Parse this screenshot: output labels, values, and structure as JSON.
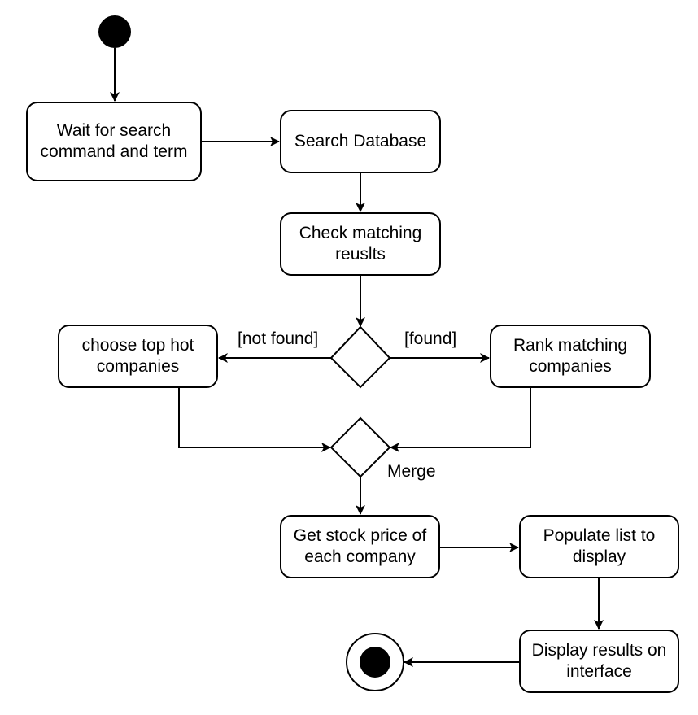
{
  "diagram": {
    "type": "UML activity diagram",
    "start": {
      "name": "initial-node"
    },
    "end": {
      "name": "final-node"
    },
    "activities": [
      {
        "id": "wait",
        "label": "Wait for search command and term"
      },
      {
        "id": "search",
        "label": "Search Database"
      },
      {
        "id": "check",
        "label": "Check matching reuslts"
      },
      {
        "id": "choose",
        "label": "choose top hot companies"
      },
      {
        "id": "rank",
        "label": "Rank matching companies"
      },
      {
        "id": "getprice",
        "label": "Get stock price of each company"
      },
      {
        "id": "populate",
        "label": "Populate list to display"
      },
      {
        "id": "display",
        "label": "Display results on interface"
      }
    ],
    "decision": {
      "id": "decision"
    },
    "merge": {
      "id": "merge",
      "label": "Merge"
    },
    "guards": {
      "not_found": "[not found]",
      "found": "[found]"
    },
    "edges": [
      {
        "from": "start",
        "to": "wait"
      },
      {
        "from": "wait",
        "to": "search"
      },
      {
        "from": "search",
        "to": "check"
      },
      {
        "from": "check",
        "to": "decision"
      },
      {
        "from": "decision",
        "to": "choose",
        "guard": "[not found]"
      },
      {
        "from": "decision",
        "to": "rank",
        "guard": "[found]"
      },
      {
        "from": "choose",
        "to": "merge"
      },
      {
        "from": "rank",
        "to": "merge"
      },
      {
        "from": "merge",
        "to": "getprice"
      },
      {
        "from": "getprice",
        "to": "populate"
      },
      {
        "from": "populate",
        "to": "display"
      },
      {
        "from": "display",
        "to": "end"
      }
    ]
  }
}
